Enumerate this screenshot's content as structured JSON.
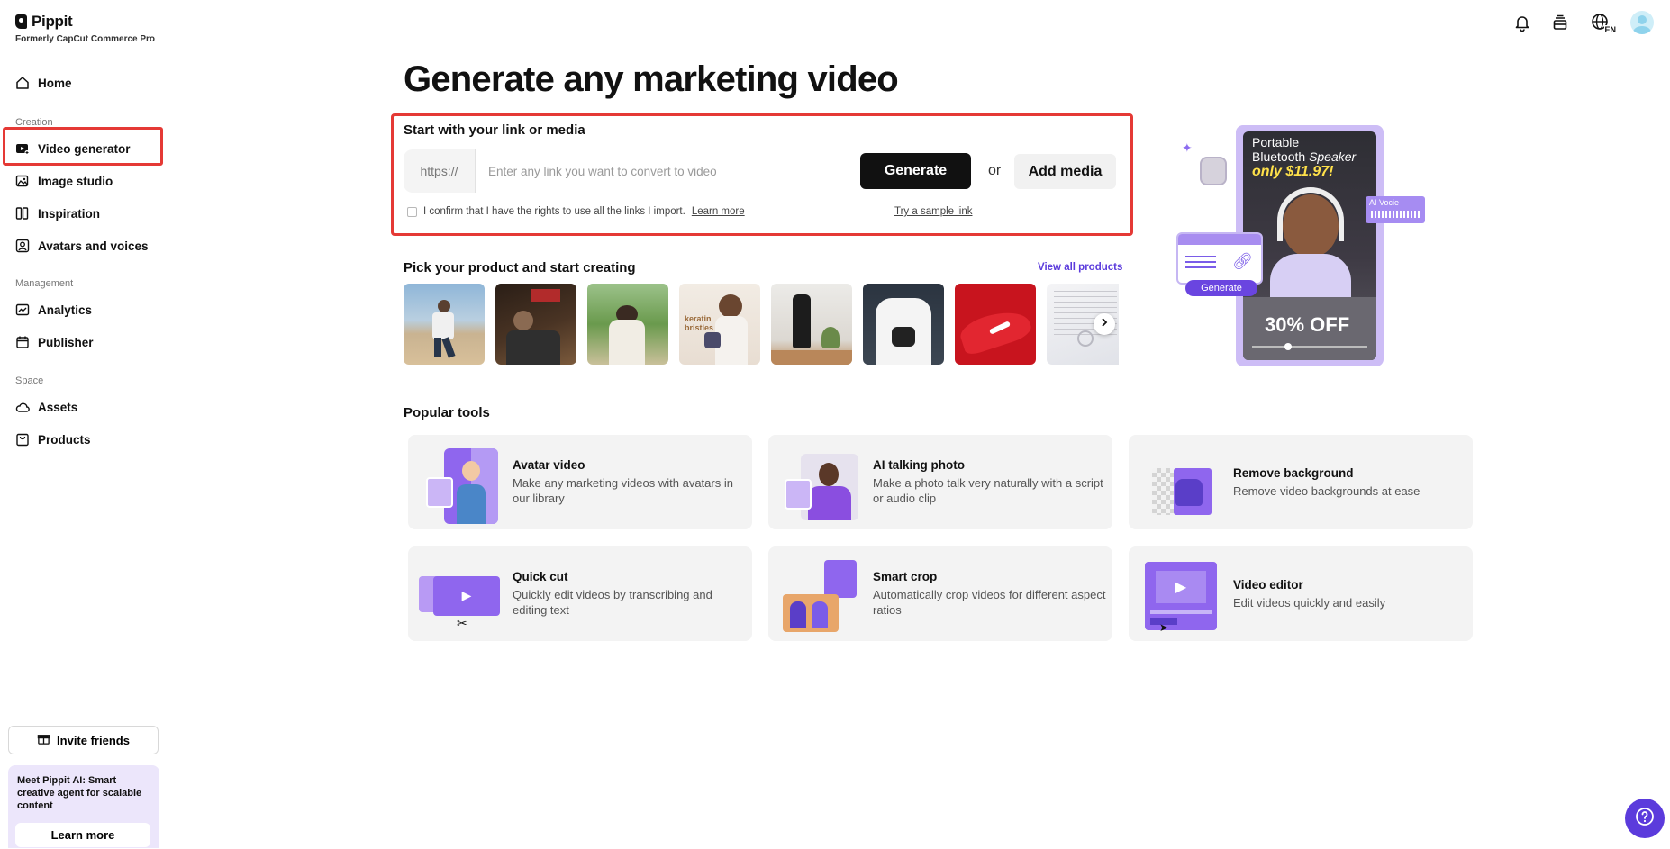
{
  "app": {
    "logo_text": "Pippit",
    "subtitle": "Formerly CapCut Commerce Pro"
  },
  "sidebar": {
    "home": "Home",
    "sections": {
      "creation": "Creation",
      "management": "Management",
      "space": "Space"
    },
    "creation_items": [
      "Video generator",
      "Image studio",
      "Inspiration",
      "Avatars and voices"
    ],
    "management_items": [
      "Analytics",
      "Publisher"
    ],
    "space_items": [
      "Assets",
      "Products"
    ],
    "active_item": "Video generator",
    "invite_label": "Invite friends",
    "promo_text": "Meet Pippit AI: Smart creative agent for scalable content",
    "promo_button": "Learn more"
  },
  "topbar": {
    "language": "EN"
  },
  "main": {
    "title": "Generate any marketing video",
    "link_section": {
      "title": "Start with your link or media",
      "prefix": "https://",
      "placeholder": "Enter any link you want to convert to video",
      "value": "",
      "generate_label": "Generate",
      "or_label": "or",
      "add_media_label": "Add media",
      "confirm_text": "I confirm that I have the rights to use all the links I import.",
      "learn_more": "Learn more",
      "sample_link": "Try a sample link"
    },
    "products": {
      "title": "Pick your product and start creating",
      "view_all": "View all products"
    },
    "hero": {
      "line1": "Portable",
      "line2": "Bluetooth",
      "line2b": "Speaker",
      "price": "only $11.97!",
      "badge": "AI Vocie",
      "generate": "Generate",
      "discount": "30% OFF"
    },
    "popular": {
      "title": "Popular tools",
      "tools": [
        {
          "name": "Avatar video",
          "desc": "Make any marketing videos with avatars in our library"
        },
        {
          "name": "AI talking photo",
          "desc": "Make a photo talk very naturally with a script or audio clip"
        },
        {
          "name": "Remove background",
          "desc": "Remove video backgrounds at ease"
        },
        {
          "name": "Quick cut",
          "desc": "Quickly edit videos by transcribing and editing text"
        },
        {
          "name": "Smart crop",
          "desc": "Automatically crop videos for different aspect ratios"
        },
        {
          "name": "Video editor",
          "desc": "Edit videos quickly and easily"
        }
      ]
    }
  },
  "colors": {
    "accent": "#5b3bdc",
    "highlight_border": "#e53935",
    "card_bg": "#f3f3f3",
    "promo_bg": "#ece6fb"
  }
}
